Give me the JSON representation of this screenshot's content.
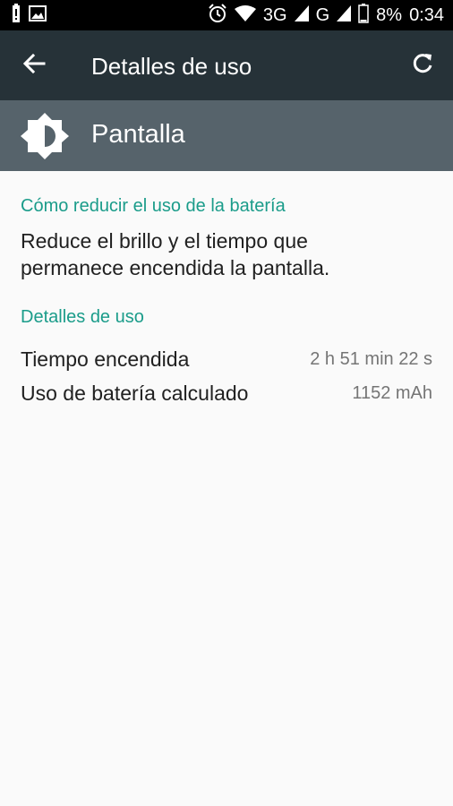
{
  "status_bar": {
    "signal_3g": "3G",
    "signal_g": "G",
    "battery_percent": "8%",
    "time": "0:34"
  },
  "app_bar": {
    "title": "Detalles de uso"
  },
  "header": {
    "title": "Pantalla"
  },
  "tips": {
    "heading": "Cómo reducir el uso de la batería",
    "lines": [
      "Reduce el brillo y el tiempo que",
      "permanece encendida la pantalla."
    ]
  },
  "usage": {
    "heading": "Detalles de uso",
    "rows": [
      {
        "label": "Tiempo encendida",
        "value": "2 h 51 min 22 s"
      },
      {
        "label": "Uso de batería calculado",
        "value": "1152 mAh"
      }
    ]
  }
}
